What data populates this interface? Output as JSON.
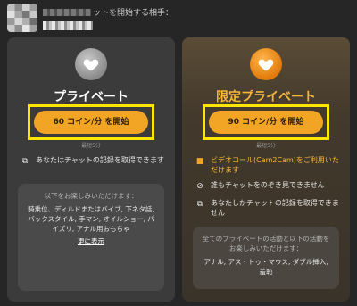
{
  "header": {
    "text": "ットを開始する相手："
  },
  "cards": [
    {
      "title": "プライベート",
      "button": "60 コイン/分 を開始",
      "min_note": "最短5分",
      "features": [
        {
          "icon": "record-video-icon",
          "text": "あなたはチャットの記録を取得できます"
        }
      ],
      "info": {
        "heading": "以下をお楽しみいただけます：",
        "body": "騎乗位、ディルドまたはバイブ, 下ネタ話, バックスタイル, 手マン, オイルショー, パイズリ, アナル用おもちゃ",
        "more": "更に表示"
      }
    },
    {
      "title": "限定プライベート",
      "button": "90 コイン/分 を開始",
      "min_note": "最短5分",
      "features": [
        {
          "icon": "camera-icon",
          "text": "ビデオコール(Cam2Cam)をご利用いただけます"
        },
        {
          "icon": "eye-off-icon",
          "text": "誰もチャットをのぞき見できません"
        },
        {
          "icon": "record-video-icon",
          "text": "あなたしかチャットの記録を取得できません"
        }
      ],
      "info": {
        "heading": "全てのプライベートの活動と以下の活動をお楽しみいただけます：",
        "body": "アナル, アス・トゥ・マウス, ダブル挿入, 羞恥"
      }
    }
  ],
  "colors": {
    "accent": "#f2a424",
    "highlight": "#ffe600",
    "gold_text": "#f5b736"
  }
}
